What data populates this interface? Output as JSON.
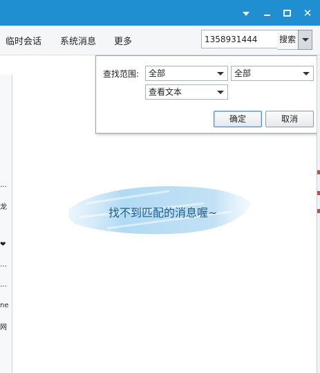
{
  "window": {
    "controls": {
      "dropdown": "chevron-down-icon",
      "minimize": "minimize-icon",
      "maximize": "maximize-icon",
      "close": "close-icon"
    }
  },
  "toolbar": {
    "tabs": [
      {
        "label": "临时会话"
      },
      {
        "label": "系统消息"
      },
      {
        "label": "更多"
      }
    ],
    "search_value": "1358931444",
    "search_label": "搜索"
  },
  "sidebar": {
    "items": [
      "…",
      "龙",
      "❤",
      "…",
      "…",
      "ne",
      "网"
    ]
  },
  "popup": {
    "range_label": "查找范围:",
    "select1": "全部",
    "select2": "全部",
    "select3": "查看文本",
    "ok_label": "确定",
    "cancel_label": "取消"
  },
  "message_area": {
    "empty_text": "找不到匹配的消息喔~"
  },
  "colors": {
    "titlebar": "#1f8fd1",
    "accent": "#1f5b8c"
  }
}
